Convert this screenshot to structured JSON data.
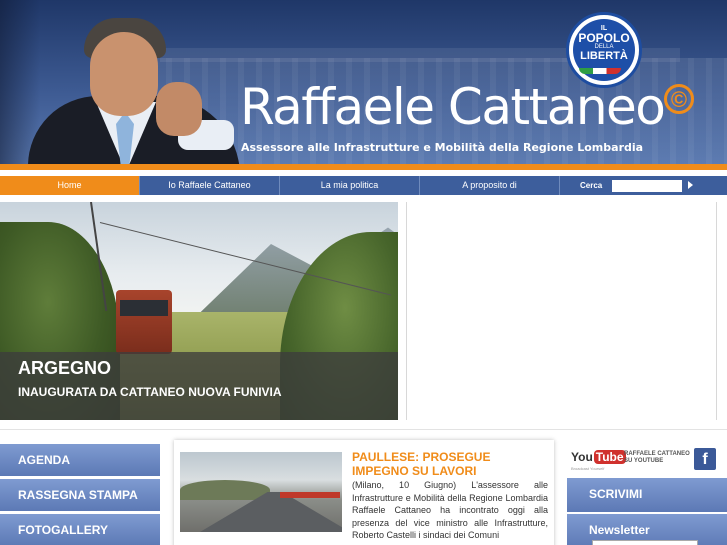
{
  "header": {
    "title": "Raffaele Cattaneo",
    "copyright_symbol": "©",
    "subtitle": "Assessore alle Infrastrutture e Mobilità della Regione Lombardia",
    "party_logo": {
      "line1": "IL",
      "line2": "POPOLO",
      "line3": "DELLA",
      "line4": "LIBERTÀ"
    }
  },
  "nav": {
    "items": [
      {
        "label": "Home"
      },
      {
        "label": "Io Raffaele Cattaneo"
      },
      {
        "label": "La mia politica"
      },
      {
        "label": "A proposito di"
      }
    ],
    "active_index": 0,
    "search_label": "Cerca",
    "search_value": ""
  },
  "hero": {
    "title": "ARGEGNO",
    "subtitle": "INAUGURATA DA CATTANEO NUOVA FUNIVIA"
  },
  "left_nav": {
    "items": [
      {
        "label": "AGENDA"
      },
      {
        "label": "RASSEGNA STAMPA"
      },
      {
        "label": "FOTOGALLERY"
      }
    ]
  },
  "news": {
    "title": "PAULLESE: PROSEGUE IMPEGNO SU LAVORI",
    "body": "(Milano, 10 Giugno) L'assessore alle Infrastrutture e Mobilità della Regione Lombardia Raffaele Cattaneo ha incontrato oggi alla presenza del vice ministro alle Infrastrutture, Roberto Castelli i sindaci dei Comuni"
  },
  "social": {
    "youtube_you": "You",
    "youtube_tube": "Tube",
    "youtube_tag": "Broadcast Yourself",
    "youtube_label": "RAFFAELE CATTANEO SU YOUTUBE",
    "facebook_glyph": "f"
  },
  "right_boxes": {
    "scrivimi": "SCRIVIMI",
    "newsletter": "Newsletter"
  },
  "colors": {
    "accent_orange": "#f08c1a",
    "nav_blue": "#3d5e9c",
    "panel_blue": "#6a86c2",
    "header_blue": "#2f4a80"
  },
  "icons": [
    "search-go-icon",
    "facebook-icon",
    "youtube-logo",
    "party-logo"
  ]
}
